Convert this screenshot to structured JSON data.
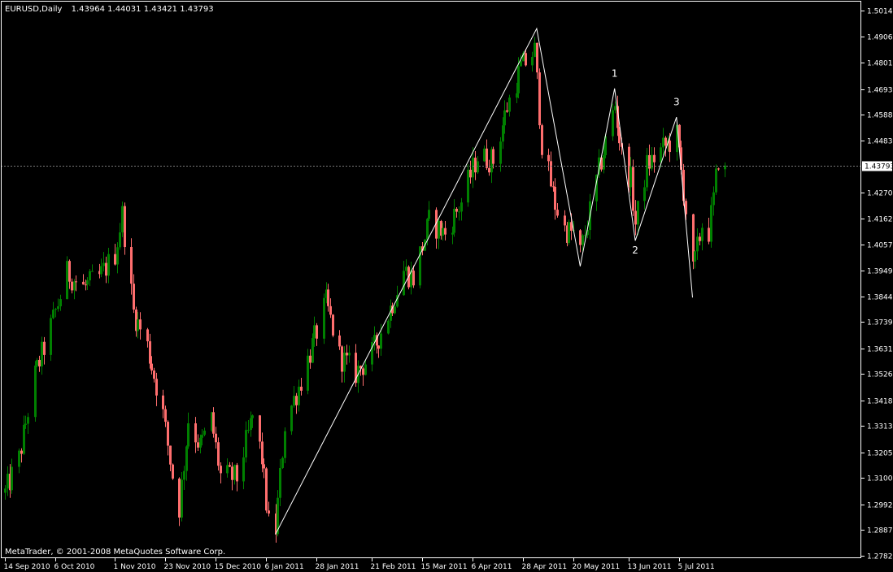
{
  "chart_data": {
    "type": "candlestick",
    "header": {
      "symbol_timeframe": "EURUSD,Daily",
      "ohlc": "1.43964 1.44031 1.43421 1.43793"
    },
    "copyright": "MetaTrader, © 2001-2008 MetaQuotes Software Corp.",
    "current_price": 1.43793,
    "current_price_label": "1.43793",
    "ylim": [
      1.2782,
      1.5014
    ],
    "y_ticks": [
      {
        "value": 1.5014,
        "label": "1.50140"
      },
      {
        "value": 1.4906,
        "label": "1.49060"
      },
      {
        "value": 1.4801,
        "label": "1.48010"
      },
      {
        "value": 1.4693,
        "label": "1.46930"
      },
      {
        "value": 1.4588,
        "label": "1.45880"
      },
      {
        "value": 1.4483,
        "label": "1.44830"
      },
      {
        "value": 1.427,
        "label": "1.42700"
      },
      {
        "value": 1.4162,
        "label": "1.41620"
      },
      {
        "value": 1.4057,
        "label": "1.40570"
      },
      {
        "value": 1.3949,
        "label": "1.39490"
      },
      {
        "value": 1.3844,
        "label": "1.38440"
      },
      {
        "value": 1.3739,
        "label": "1.37390"
      },
      {
        "value": 1.3631,
        "label": "1.36310"
      },
      {
        "value": 1.3526,
        "label": "1.35260"
      },
      {
        "value": 1.3418,
        "label": "1.34180"
      },
      {
        "value": 1.3313,
        "label": "1.33130"
      },
      {
        "value": 1.3205,
        "label": "1.32050"
      },
      {
        "value": 1.31,
        "label": "1.31000"
      },
      {
        "value": 1.2992,
        "label": "1.29920"
      },
      {
        "value": 1.2887,
        "label": "1.28870"
      },
      {
        "value": 1.2782,
        "label": "1.27820"
      }
    ],
    "x_ticks": [
      {
        "date": "2010-09-14",
        "label": "14 Sep 2010"
      },
      {
        "date": "2010-10-06",
        "label": "6 Oct 2010"
      },
      {
        "date": "2010-11-01",
        "label": "1 Nov 2010"
      },
      {
        "date": "2010-11-23",
        "label": "23 Nov 2010"
      },
      {
        "date": "2010-12-15",
        "label": "15 Dec 2010"
      },
      {
        "date": "2011-01-06",
        "label": "6 Jan 2011"
      },
      {
        "date": "2011-01-28",
        "label": "28 Jan 2011"
      },
      {
        "date": "2011-02-21",
        "label": "21 Feb 2011"
      },
      {
        "date": "2011-03-15",
        "label": "15 Mar 2011"
      },
      {
        "date": "2011-04-06",
        "label": "6 Apr 2011"
      },
      {
        "date": "2011-04-28",
        "label": "28 Apr 2011"
      },
      {
        "date": "2011-05-20",
        "label": "20 May 2011"
      },
      {
        "date": "2011-06-13",
        "label": "13 Jun 2011"
      },
      {
        "date": "2011-07-05",
        "label": "5 Jul 2011"
      }
    ],
    "price_path": [
      [
        "2010-09-14",
        1.304
      ],
      [
        "2010-09-20",
        1.318
      ],
      [
        "2010-09-27",
        1.352
      ],
      [
        "2010-10-04",
        1.372
      ],
      [
        "2010-10-11",
        1.394
      ],
      [
        "2010-10-18",
        1.388
      ],
      [
        "2010-10-25",
        1.392
      ],
      [
        "2010-11-01",
        1.402
      ],
      [
        "2010-11-04",
        1.418
      ],
      [
        "2010-11-09",
        1.378
      ],
      [
        "2010-11-15",
        1.364
      ],
      [
        "2010-11-22",
        1.336
      ],
      [
        "2010-11-26",
        1.311
      ],
      [
        "2010-11-29",
        1.298
      ],
      [
        "2010-12-03",
        1.334
      ],
      [
        "2010-12-08",
        1.323
      ],
      [
        "2010-12-13",
        1.334
      ],
      [
        "2010-12-17",
        1.311
      ],
      [
        "2010-12-24",
        1.31
      ],
      [
        "2010-12-31",
        1.335
      ],
      [
        "2011-01-04",
        1.318
      ],
      [
        "2011-01-07",
        1.291
      ],
      [
        "2011-01-10",
        1.289
      ],
      [
        "2011-01-14",
        1.332
      ],
      [
        "2011-01-21",
        1.35
      ],
      [
        "2011-01-28",
        1.37
      ],
      [
        "2011-02-01",
        1.382
      ],
      [
        "2011-02-07",
        1.36
      ],
      [
        "2011-02-14",
        1.353
      ],
      [
        "2011-02-21",
        1.361
      ],
      [
        "2011-02-28",
        1.377
      ],
      [
        "2011-03-07",
        1.395
      ],
      [
        "2011-03-11",
        1.392
      ],
      [
        "2011-03-18",
        1.415
      ],
      [
        "2011-03-25",
        1.41
      ],
      [
        "2011-04-01",
        1.423
      ],
      [
        "2011-04-08",
        1.442
      ],
      [
        "2011-04-15",
        1.44
      ],
      [
        "2011-04-21",
        1.462
      ],
      [
        "2011-04-27",
        1.478
      ],
      [
        "2011-05-03",
        1.485
      ],
      [
        "2011-05-06",
        1.447
      ],
      [
        "2011-05-12",
        1.422
      ],
      [
        "2011-05-16",
        1.412
      ],
      [
        "2011-05-20",
        1.41
      ],
      [
        "2011-05-23",
        1.402
      ],
      [
        "2011-06-01",
        1.44
      ],
      [
        "2011-06-07",
        1.463
      ],
      [
        "2011-06-10",
        1.442
      ],
      [
        "2011-06-14",
        1.432
      ],
      [
        "2011-06-16",
        1.414
      ],
      [
        "2011-06-21",
        1.438
      ],
      [
        "2011-06-28",
        1.445
      ],
      [
        "2011-07-04",
        1.45
      ],
      [
        "2011-07-07",
        1.428
      ],
      [
        "2011-07-11",
        1.394
      ],
      [
        "2011-07-13",
        1.404
      ],
      [
        "2011-07-15",
        1.414
      ],
      [
        "2011-07-18",
        1.411
      ],
      [
        "2011-07-20",
        1.424
      ],
      [
        "2011-07-22",
        1.441
      ],
      [
        "2011-07-25",
        1.4379
      ]
    ],
    "candle_start": "2010-09-14",
    "candle_end": "2011-07-25",
    "bull_color": "#008000",
    "bear_color": "#FF6E6E",
    "zigzag": [
      {
        "date": "2011-01-10",
        "price": 1.2869
      },
      {
        "date": "2011-05-04",
        "price": 1.494
      },
      {
        "date": "2011-05-23",
        "price": 1.3967
      },
      {
        "date": "2011-06-07",
        "price": 1.4695
      },
      {
        "date": "2011-06-16",
        "price": 1.4072
      },
      {
        "date": "2011-07-04",
        "price": 1.4578
      },
      {
        "date": "2011-07-11",
        "price": 1.3839
      }
    ],
    "annotations": [
      {
        "text": "1",
        "date": "2011-06-07",
        "price": 1.4743
      },
      {
        "text": "2",
        "date": "2011-06-16",
        "price": 1.402
      },
      {
        "text": "3",
        "date": "2011-07-04",
        "price": 1.4626
      }
    ],
    "grid": false,
    "background": "#000000",
    "foreground": "#FFFFFF"
  }
}
